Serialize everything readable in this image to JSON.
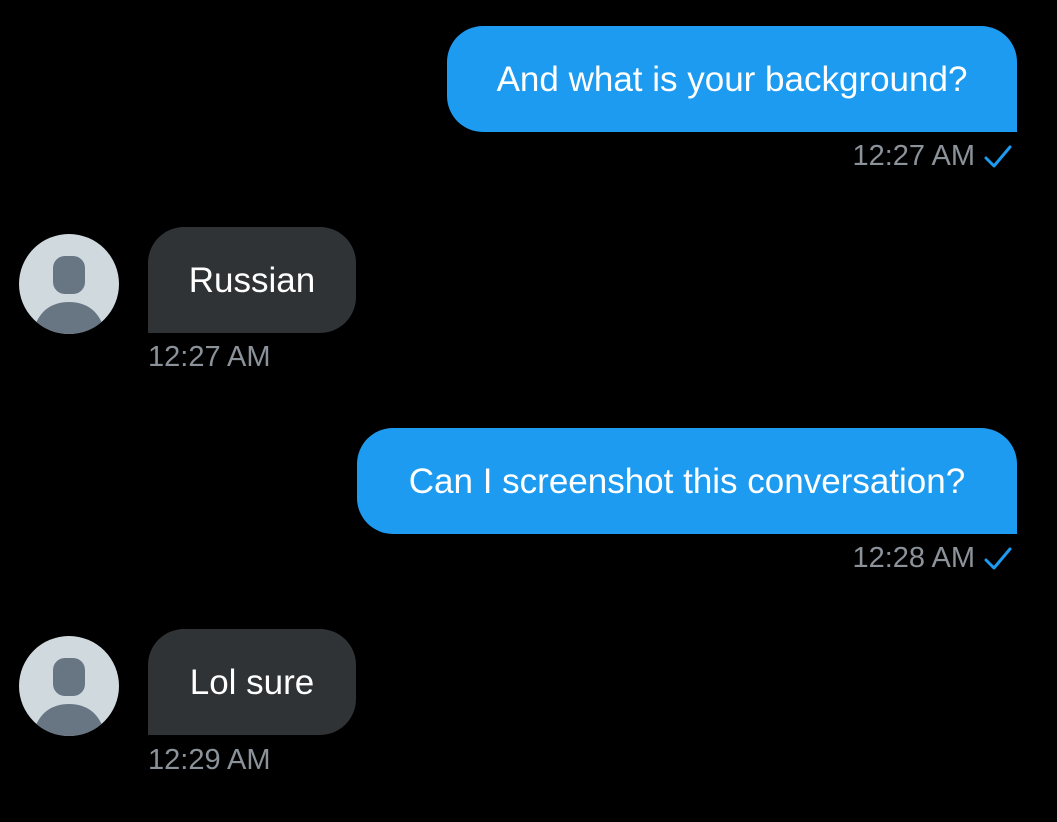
{
  "colors": {
    "background": "#000000",
    "sent_bubble": "#1d9bf0",
    "received_bubble": "#2f3336",
    "timestamp": "#8b9299",
    "read_check": "#1d9bf0",
    "avatar_bg": "#cfd9de",
    "avatar_figure": "#687684"
  },
  "messages": [
    {
      "direction": "sent",
      "text": "And what is your background?",
      "time": "12:27 AM",
      "status_icon": "check-icon"
    },
    {
      "direction": "received",
      "text": "Russian",
      "time": "12:27 AM",
      "avatar_icon": "default-profile-avatar-icon"
    },
    {
      "direction": "sent",
      "text": "Can I screenshot this conversation?",
      "time": "12:28 AM",
      "status_icon": "check-icon"
    },
    {
      "direction": "received",
      "text": "Lol sure",
      "time": "12:29 AM",
      "avatar_icon": "default-profile-avatar-icon"
    }
  ]
}
